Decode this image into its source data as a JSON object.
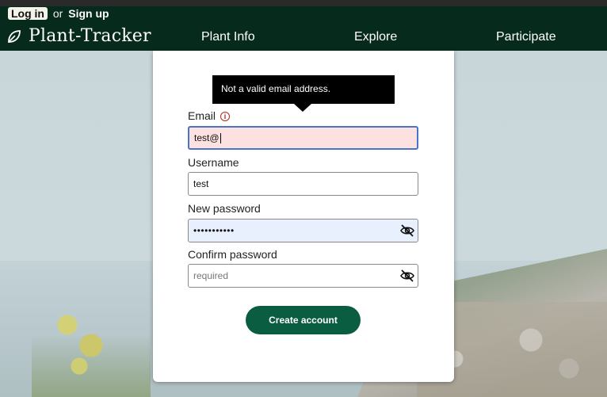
{
  "header": {
    "login_label": "Log in",
    "or_text": "or",
    "signup_label": "Sign up",
    "brand_name": "Plant-Tracker",
    "nav": [
      {
        "label": "Plant Info"
      },
      {
        "label": "Explore"
      },
      {
        "label": "Participate"
      }
    ]
  },
  "form": {
    "tooltip": "Not a valid email address.",
    "email": {
      "label": "Email",
      "value": "test@"
    },
    "username": {
      "label": "Username",
      "value": "test"
    },
    "new_password": {
      "label": "New password",
      "value": "•••••••••••"
    },
    "confirm_password": {
      "label": "Confirm password",
      "placeholder": "required"
    },
    "submit_label": "Create account"
  },
  "colors": {
    "nav_bg": "#062b1d",
    "button_bg": "#0b5d42",
    "invalid_field_bg": "#fde1e1",
    "error": "#b3261e"
  },
  "icons": [
    "leaf-icon",
    "error-info-icon",
    "eye-slash-icon"
  ]
}
